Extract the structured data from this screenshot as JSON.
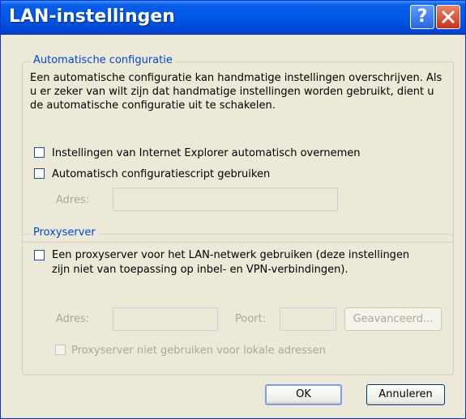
{
  "window": {
    "title": "LAN-instellingen",
    "help_symbol": "?",
    "close_symbol": "✕"
  },
  "auto_config": {
    "legend": "Automatische configuratie",
    "description": "Een automatische configuratie kan handmatige instellingen overschrijven. Als u er zeker van wilt zijn dat handmatige instellingen worden gebruikt, dient u de automatische configuratie uit te schakelen.",
    "auto_detect_label": "Instellingen van Internet Explorer automatisch overnemen",
    "auto_detect_checked": false,
    "script_label": "Automatisch configuratiescript gebruiken",
    "script_checked": false,
    "address_label": "Adres:",
    "address_value": ""
  },
  "proxy": {
    "legend": "Proxyserver",
    "use_proxy_label": "Een proxyserver voor het LAN-netwerk gebruiken (deze instellingen zijn niet van toepassing op inbel- en VPN-verbindingen).",
    "use_proxy_checked": false,
    "address_label": "Adres:",
    "address_value": "",
    "port_label": "Poort:",
    "port_value": "",
    "advanced_button": "Geavanceerd...",
    "bypass_label": "Proxyserver niet gebruiken voor lokale adressen",
    "bypass_checked": false
  },
  "buttons": {
    "ok": "OK",
    "cancel": "Annuleren"
  },
  "colors": {
    "titlebar": "#0058e6",
    "dialog_bg": "#ece9d8",
    "group_legend": "#0046d5",
    "disabled_text": "#aca899"
  }
}
